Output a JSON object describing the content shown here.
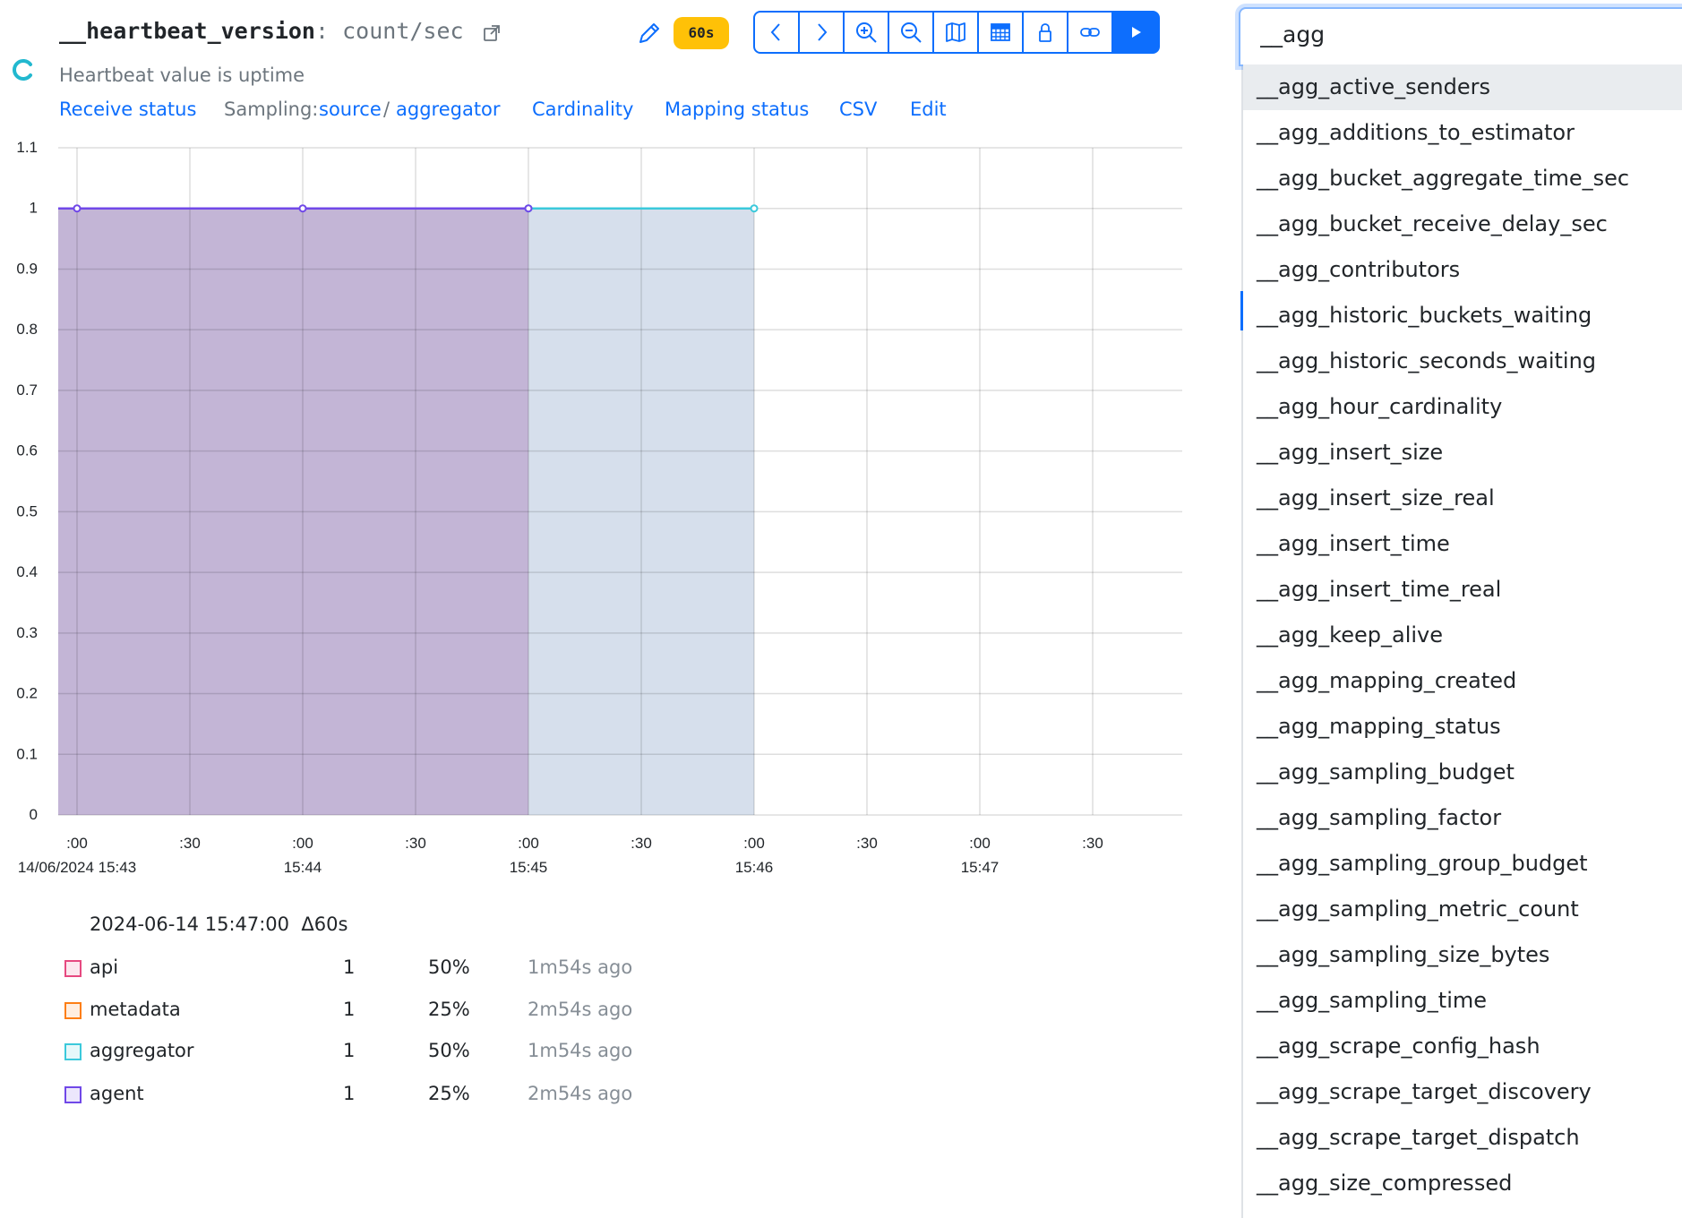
{
  "header": {
    "metric_name": "__heartbeat_version",
    "separator": ":",
    "unit": "count/sec",
    "subtitle": "Heartbeat value is uptime",
    "interval_badge": "60s"
  },
  "links": {
    "receive_status": "Receive status",
    "sampling_label": "Sampling:",
    "sampling_source": "source",
    "sampling_slash": "/",
    "sampling_aggregator": "aggregator",
    "cardinality": "Cardinality",
    "mapping_status": "Mapping status",
    "csv": "CSV",
    "edit": "Edit"
  },
  "toolbar": {
    "icons": [
      "chevron-left-icon",
      "chevron-right-icon",
      "zoom-in-icon",
      "zoom-out-icon",
      "map-icon",
      "table-icon",
      "lock-icon",
      "link-icon",
      "play-icon"
    ],
    "accent": "#0d6efd"
  },
  "chart_data": {
    "type": "area",
    "y_ticks": [
      "1.1",
      "1",
      "0.9",
      "0.8",
      "0.7",
      "0.6",
      "0.5",
      "0.4",
      "0.3",
      "0.2",
      "0.1",
      "0"
    ],
    "ylim": [
      0,
      1.1
    ],
    "x_ticks": [
      {
        "top": ":00",
        "bottom": "14/06/2024 15:43"
      },
      {
        "top": ":30",
        "bottom": ""
      },
      {
        "top": ":00",
        "bottom": "15:44"
      },
      {
        "top": ":30",
        "bottom": ""
      },
      {
        "top": ":00",
        "bottom": "15:45"
      },
      {
        "top": ":30",
        "bottom": ""
      },
      {
        "top": ":00",
        "bottom": "15:46"
      },
      {
        "top": ":30",
        "bottom": ""
      },
      {
        "top": ":00",
        "bottom": "15:47"
      },
      {
        "top": ":30",
        "bottom": ""
      }
    ],
    "series": [
      {
        "name": "agent",
        "color": "#7048e8",
        "fill": "#c3b5d6",
        "x": [
          "15:43:00",
          "15:44:00",
          "15:45:00"
        ],
        "y": [
          1,
          1,
          1
        ]
      },
      {
        "name": "aggregator",
        "color": "#3bc9db",
        "fill": "#d6dfec",
        "x": [
          "15:45:00",
          "15:46:00"
        ],
        "y": [
          1,
          1
        ]
      }
    ],
    "grid": true
  },
  "legend": {
    "time": "2024-06-14 15:47:00",
    "delta": "Δ60s",
    "rows": [
      {
        "name": "api",
        "value": "1",
        "percent": "50%",
        "ago": "1m54s ago",
        "color": "#e64980"
      },
      {
        "name": "metadata",
        "value": "1",
        "percent": "25%",
        "ago": "2m54s ago",
        "color": "#fd7e14"
      },
      {
        "name": "aggregator",
        "value": "1",
        "percent": "50%",
        "ago": "1m54s ago",
        "color": "#3bc9db"
      },
      {
        "name": "agent",
        "value": "1",
        "percent": "25%",
        "ago": "2m54s ago",
        "color": "#7048e8"
      }
    ]
  },
  "search": {
    "value": "__agg",
    "options": [
      "__agg_active_senders",
      "__agg_additions_to_estimator",
      "__agg_bucket_aggregate_time_sec",
      "__agg_bucket_receive_delay_sec",
      "__agg_contributors",
      "__agg_historic_buckets_waiting",
      "__agg_historic_seconds_waiting",
      "__agg_hour_cardinality",
      "__agg_insert_size",
      "__agg_insert_size_real",
      "__agg_insert_time",
      "__agg_insert_time_real",
      "__agg_keep_alive",
      "__agg_mapping_created",
      "__agg_mapping_status",
      "__agg_sampling_budget",
      "__agg_sampling_factor",
      "__agg_sampling_group_budget",
      "__agg_sampling_metric_count",
      "__agg_sampling_size_bytes",
      "__agg_sampling_time",
      "__agg_scrape_config_hash",
      "__agg_scrape_target_discovery",
      "__agg_scrape_target_dispatch",
      "__agg_size_compressed"
    ]
  }
}
